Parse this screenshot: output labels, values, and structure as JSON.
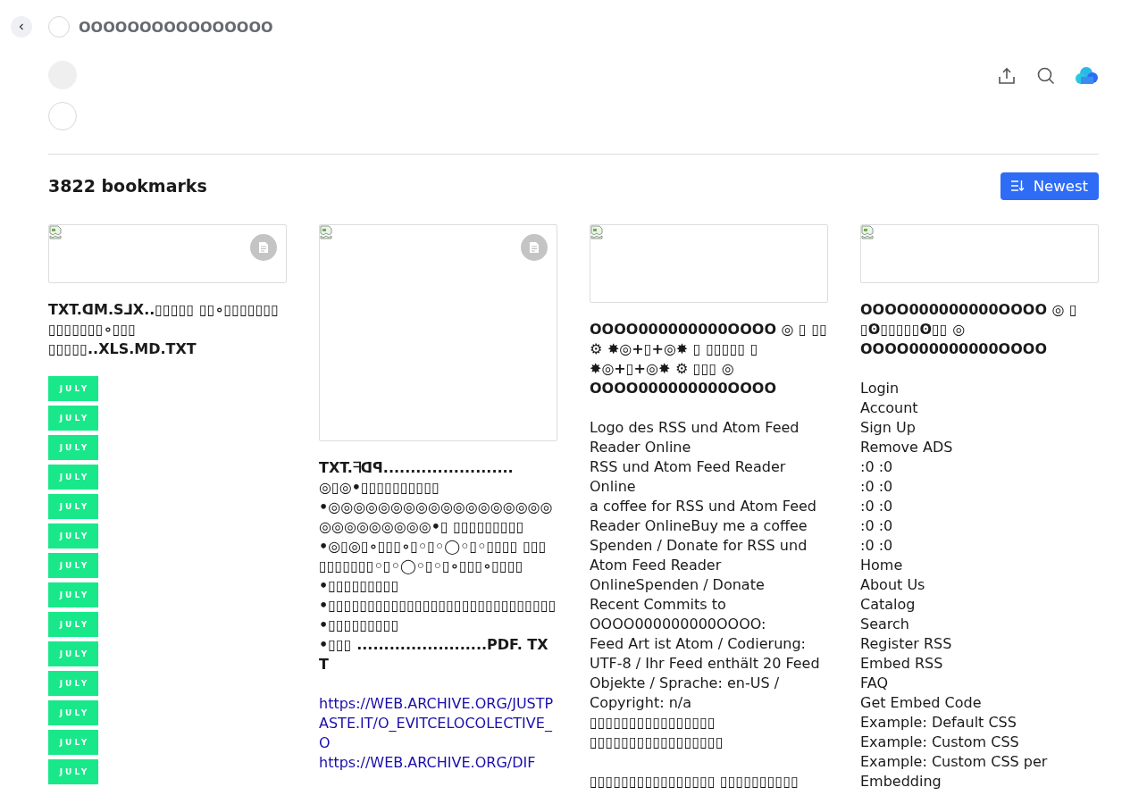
{
  "header": {
    "title": "OOOOOOOOOOOOOOOO"
  },
  "bookmarks_count": "3822 bookmarks",
  "sort_button": {
    "label": "Newest"
  },
  "bookmarks": [
    {
      "kind": "wide",
      "has_doc_icon": true,
      "title": "TXT.ᗡM.S⅃X..▯▯▯▯▯ ▯▯∘▯▯▯▯▯▯▯ ▯▯▯▯▯▯▯∘▯▯▯ ▯▯▯▯▯..XLS.MD.TXT",
      "tags": [
        "JULY",
        "JULY",
        "JULY",
        "JULY",
        "JULY",
        "JULY",
        "JULY",
        "JULY",
        "JULY",
        "JULY",
        "JULY",
        "JULY",
        "JULY",
        "JULY"
      ]
    },
    {
      "kind": "tall",
      "has_doc_icon": true,
      "title_lines": [
        "TXT.ᖷᗡꟼ........................",
        "◎▯◎•▯▯▯▯▯▯▯▯▯▯",
        "•◎◎◎◎◎◎◎◎◎◎◎◎◎◎◎◎◎◎◎◎◎◎◎◎◎◎◎•▯ ▯▯▯▯▯▯▯▯▯",
        "•◎▯◎▯∘▯▯▯∘▯◦▯◦◯◦▯◦▯▯▯▯ ▯▯▯",
        "▯▯▯▯▯▯▯◦▯◦◯◦▯◦▯∘▯▯▯∘▯▯▯▯",
        "•▯▯▯▯▯▯▯▯▯",
        "•▯▯▯▯▯▯▯▯▯▯▯▯▯▯▯▯▯▯▯▯▯▯▯▯▯▯▯▯▯•▯▯▯▯▯▯▯▯▯",
        "•▯▯▯ ........................PDF. TXT"
      ],
      "links": [
        "https://WEB.ARCHIVE.ORG/JUSTPASTE.IT/O_EVITCELOCOLECTIVE_O",
        "https://WEB.ARCHIVE.ORG/DIF"
      ]
    },
    {
      "kind": "medium",
      "has_doc_icon": false,
      "title": "OOOO000000000OOOO ◎ ▯ ▯▯ ⚙ ✸◎+▯+◎✸ ▯ ▯▯▯▯▯ ▯ ✸◎+▯+◎✸ ⚙ ▯▯▯ ◎ OOOO000000000OOOO",
      "paragraphs": [
        [
          "Logo des RSS und Atom Feed Reader Online",
          "RSS und Atom Feed Reader Online",
          "a coffee for RSS und Atom Feed Reader OnlineBuy me a coffee",
          "Spenden / Donate for RSS und Atom Feed Reader OnlineSpenden / Donate",
          "Recent Commits to OOOO000000000OOOO:",
          "Feed Art ist Atom / Codierung: UTF-8 / Ihr Feed enthält 20 Feed Objekte / Sprache: en-US / Copyright: n/a",
          "▯▯▯▯▯▯▯▯▯▯▯▯▯▯▯▯ ▯▯▯▯▯▯▯▯▯▯▯▯▯▯▯▯▯"
        ],
        [
          "▯▯▯▯▯▯▯▯▯▯▯▯▯▯▯▯ ▯▯▯▯▯▯▯▯▯▯"
        ]
      ]
    },
    {
      "kind": "wide",
      "has_doc_icon": false,
      "title": "OOOO000000000OOOO ◎ ▯ ▯ʘ▯▯▯▯▯ʘ▯▯ ◎ OOOO000000000OOOO",
      "paragraphs": [
        [
          "Login",
          "Account",
          "Sign Up",
          "Remove ADS",
          ":0 :0",
          ":0 :0",
          ":0 :0",
          ":0 :0",
          ":0 :0",
          "Home",
          "About Us",
          "Catalog",
          "Search",
          "Register RSS",
          "Embed RSS",
          "FAQ",
          "Get Embed Code",
          "Example: Default CSS",
          "Example: Custom CSS",
          "Example: Custom CSS per Embedding"
        ]
      ]
    }
  ]
}
